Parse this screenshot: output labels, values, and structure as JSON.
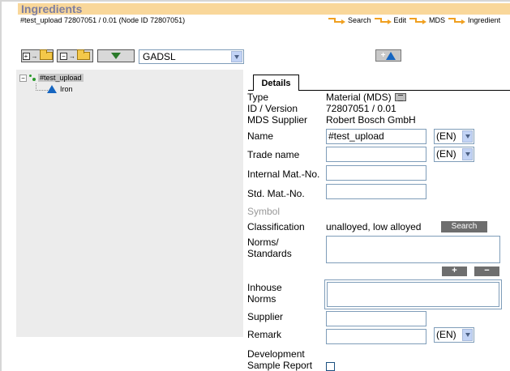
{
  "header": {
    "title": "Ingredients",
    "node_line": "#test_upload 72807051 / 0.01 (Node ID 72807051)",
    "breadcrumbs": [
      "Search",
      "Edit",
      "MDS",
      "Ingredient"
    ]
  },
  "toolbar": {
    "list_select_value": "GADSL",
    "add_button_label": "+"
  },
  "tree": {
    "root_label": "#test_upload",
    "child_label": "Iron"
  },
  "tabs": {
    "details": "Details"
  },
  "form": {
    "type_label": "Type",
    "type_value": "Material (MDS)",
    "id_version_label": "ID / Version",
    "id_version_value": "72807051 / 0.01",
    "mds_supplier_label": "MDS Supplier",
    "mds_supplier_value": "Robert Bosch GmbH",
    "name_label": "Name",
    "name_value": "#test_upload",
    "name_lang": "(EN)",
    "trade_name_label": "Trade name",
    "trade_name_lang": "(EN)",
    "internal_mat_no_label": "Internal Mat.-No.",
    "std_mat_no_label": "Std. Mat.-No.",
    "symbol_label": "Symbol",
    "classification_label": "Classification",
    "classification_value": "unalloyed, low alloyed",
    "search_button": "Search",
    "norms_label_1": "Norms/",
    "norms_label_2": "Standards",
    "plus_button": "+",
    "minus_button": "−",
    "inhouse_label_1": "Inhouse",
    "inhouse_label_2": "Norms",
    "supplier_label": "Supplier",
    "remark_label": "Remark",
    "remark_lang": "(EN)",
    "dev_label_1": "Development",
    "dev_label_2": "Sample Report"
  },
  "colors": {
    "header_bar": "#f9d79a",
    "header_title": "#7f7f9f",
    "breadcrumb_arrow": "#f0a020",
    "tree_panel": "#ececec",
    "gray_button": "#6e6e6e",
    "node_triangle": "#1565c0"
  }
}
